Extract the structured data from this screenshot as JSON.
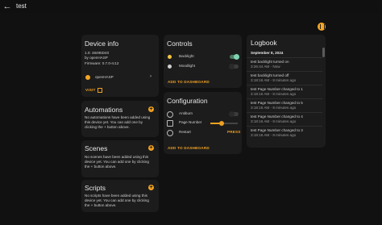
{
  "header": {
    "title": "test",
    "back_icon": "arrow-left-icon"
  },
  "device_info": {
    "title": "Device info",
    "model_line": "1.0: 48495D40",
    "by_line": "by openHASP",
    "firmware": "Firmware: 0.7.0-rc12",
    "integration": "openHASP",
    "visit": "VISIT"
  },
  "automations": {
    "title": "Automations",
    "text": "No automations have been added using this device yet. You can add one by clicking the + button above."
  },
  "scenes": {
    "title": "Scenes",
    "text": "No scenes have been added using this device yet. You can add one by clicking the + button above."
  },
  "scripts": {
    "title": "Scripts",
    "text": "No scripts have been added using this device yet. You can add one by clicking the + button above."
  },
  "controls": {
    "title": "Controls",
    "items": [
      {
        "label": "Backlight",
        "state": "on"
      },
      {
        "label": "Moodlight",
        "state": "off"
      }
    ],
    "add": "ADD TO DASHBOARD",
    "colors": {
      "on_track": "#4c7a62",
      "on_knob": "#7ed3b2",
      "bulb_on": "#f5c542",
      "bulb_off": "#d0d0d0"
    }
  },
  "configuration": {
    "title": "Configuration",
    "items": [
      {
        "label": "Antiburn"
      },
      {
        "label": "Page Number"
      },
      {
        "label": "Restart",
        "action": "PRESS"
      }
    ],
    "page_number_level": 0.4,
    "add": "ADD TO DASHBOARD"
  },
  "logbook": {
    "title": "Logbook",
    "date": "September 8, 2024",
    "entries": [
      {
        "text": "test backlight turned on",
        "time": "3:26:44 AM - Now"
      },
      {
        "text": "test backlight turned off",
        "time": "3:18:16 AM - 8 minutes ago"
      },
      {
        "text": "test Page Number changed to 1",
        "time": "3:18:16 AM - 8 minutes ago"
      },
      {
        "text": "test Page Number changed to 5",
        "time": "3:18:16 AM - 8 minutes ago"
      },
      {
        "text": "test Page Number changed to 4",
        "time": "3:18:16 AM - 8 minutes ago"
      },
      {
        "text": "test Page Number changed to 3",
        "time": "3:18:16 AM - 8 minutes ago"
      }
    ]
  },
  "accent_color": "#f0a020"
}
